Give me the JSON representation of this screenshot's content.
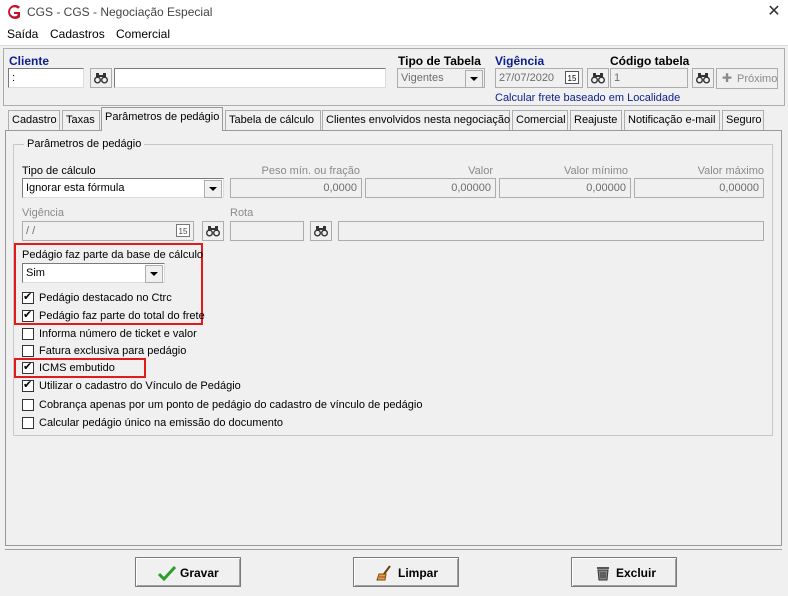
{
  "window": {
    "title": "CGS - CGS - Negociação Especial",
    "close": "✕"
  },
  "menu": [
    "Saída",
    "Cadastros",
    "Comercial"
  ],
  "header": {
    "cliente_label": "Cliente",
    "cliente_value": ":",
    "cliente_name": "",
    "tipo_tabela_label": "Tipo de Tabela",
    "tipo_tabela_value": "Vigentes",
    "vigencia_label": "Vigência",
    "vigencia_value": "27/07/2020",
    "calendar_badge": "15",
    "codigo_label": "Código tabela",
    "codigo_value": "1",
    "proximo_label": "Próximo",
    "calcular_text": "Calcular frete baseado em Localidade"
  },
  "tabs": [
    "Cadastro",
    "Taxas",
    "Parâmetros de pedágio",
    "Tabela de cálculo",
    "Clientes envolvidos nesta negociação",
    "Comercial",
    "Reajuste",
    "Notificação e-mail",
    "Seguro"
  ],
  "active_tab": "Parâmetros de pedágio",
  "group": {
    "title": "Parâmetros de pedágio",
    "tipo_calculo_label": "Tipo de cálculo",
    "tipo_calculo_value": "Ignorar esta fórmula",
    "peso_label": "Peso mín. ou fração",
    "peso_value": "0,0000",
    "valor_label": "Valor",
    "valor_value": "0,00000",
    "valor_min_label": "Valor mínimo",
    "valor_min_value": "0,00000",
    "valor_max_label": "Valor máximo",
    "valor_max_value": "0,00000",
    "vigencia_label": "Vigência",
    "vigencia_value": " / /",
    "calendar_badge": "15",
    "rota_label": "Rota",
    "rota_value": "",
    "rota_desc": "",
    "base_calc_label": "Pedágio faz parte da base de cálculo",
    "base_calc_value": "Sim"
  },
  "checkboxes": [
    {
      "label": "Pedágio destacado no Ctrc",
      "checked": true
    },
    {
      "label": "Pedágio faz parte do total do frete",
      "checked": true
    },
    {
      "label": "Informa número de ticket e valor",
      "checked": false
    },
    {
      "label": "Fatura exclusiva para pedágio",
      "checked": false
    },
    {
      "label": "ICMS embutido",
      "checked": true
    },
    {
      "label": "Utilizar o cadastro do Vínculo de Pedágio",
      "checked": true
    },
    {
      "label": "Cobrança apenas por um ponto de pedágio do cadastro de vínculo de pedágio",
      "checked": false
    },
    {
      "label": "Calcular pedágio único na emissão do documento",
      "checked": false
    }
  ],
  "buttons": {
    "gravar": "Gravar",
    "limpar": "Limpar",
    "excluir": "Excluir"
  },
  "colors": {
    "accent_label": "#0c1f8a",
    "highlight": "#e21a1a",
    "logo": "#c8102e",
    "gravar_icon": "#2a9d2a"
  }
}
